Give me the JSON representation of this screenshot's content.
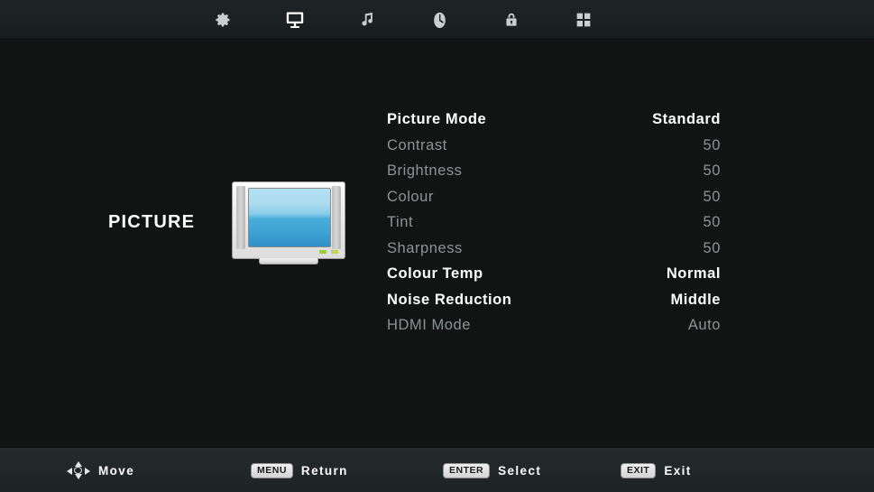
{
  "screen": {
    "title": "PICTURE",
    "background_color": "#121414",
    "topbar_color": "#1e2325",
    "bottombar_color": "#24292a",
    "accent_active_color": "#ffffff",
    "accent_dim_color": "#8d9394"
  },
  "topbar": {
    "icons": [
      {
        "name": "gear-icon",
        "label": "Setup",
        "selected": false
      },
      {
        "name": "monitor-icon",
        "label": "Picture",
        "selected": true
      },
      {
        "name": "music-note-icon",
        "label": "Sound",
        "selected": false
      },
      {
        "name": "clock-icon",
        "label": "Time",
        "selected": false
      },
      {
        "name": "lock-icon",
        "label": "Lock",
        "selected": false
      },
      {
        "name": "grid-icon",
        "label": "Option",
        "selected": false
      }
    ]
  },
  "section": {
    "name": "PICTURE",
    "icon": "crt-television-icon"
  },
  "settings": {
    "rows": [
      {
        "label": "Picture Mode",
        "value": "Standard",
        "enabled": true
      },
      {
        "label": "Contrast",
        "value": "50",
        "enabled": false
      },
      {
        "label": "Brightness",
        "value": "50",
        "enabled": false
      },
      {
        "label": "Colour",
        "value": "50",
        "enabled": false
      },
      {
        "label": "Tint",
        "value": "50",
        "enabled": false
      },
      {
        "label": "Sharpness",
        "value": "50",
        "enabled": false
      },
      {
        "label": "Colour Temp",
        "value": "Normal",
        "enabled": true
      },
      {
        "label": "Noise Reduction",
        "value": "Middle",
        "enabled": true
      },
      {
        "label": "HDMI Mode",
        "value": "Auto",
        "enabled": false
      }
    ]
  },
  "footer": {
    "hints": [
      {
        "key": "",
        "icon": "dpad-arrows-icon",
        "action": "Move"
      },
      {
        "key": "MENU",
        "icon": "",
        "action": "Return"
      },
      {
        "key": "ENTER",
        "icon": "",
        "action": "Select"
      },
      {
        "key": "EXIT",
        "icon": "",
        "action": "Exit"
      }
    ]
  }
}
